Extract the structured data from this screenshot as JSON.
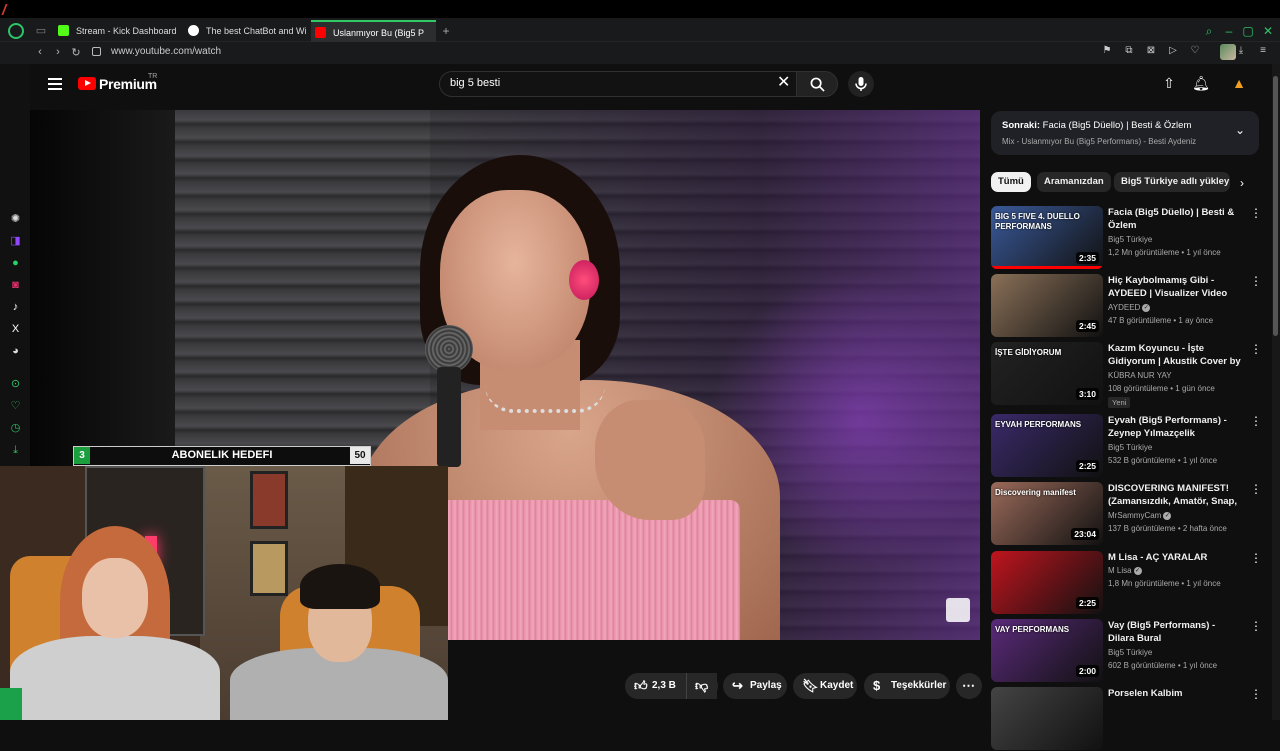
{
  "browser": {
    "tabs": [
      {
        "label": "Stream - Kick Dashboard",
        "color": "#53fc18"
      },
      {
        "label": "The best ChatBot and Wi",
        "color": "#ffffff"
      },
      {
        "label": "Uslanmıyor Bu (Big5 P",
        "color": "#ff0000",
        "active": true
      }
    ],
    "url": "www.youtube.com/watch"
  },
  "youtube": {
    "logo_text": "Premium",
    "country": "TR",
    "search_value": "big 5 besti"
  },
  "overlay": {
    "sub_goal_label": "ABONELIK HEDEFI",
    "sub_goal_current": "3",
    "sub_goal_target": "50"
  },
  "actions": {
    "likes": "2,3 B",
    "share": "Paylaş",
    "save": "Kaydet",
    "thanks": "Teşekkürler"
  },
  "next_up": {
    "label": "Sonraki:",
    "title": "Facia (Big5 Düello) | Besti & Özlem",
    "subtitle": "Mix - Uslanmıyor Bu (Big5 Performans) - Besti Aydeniz"
  },
  "chips": [
    "Tümü",
    "Aramanızdan",
    "Big5 Türkiye adlı yükley"
  ],
  "recommendations": [
    {
      "title": "Facia (Big5 Düello) | Besti & Özlem",
      "channel": "Big5 Türkiye",
      "meta": "1,2 Mn görüntüleme • 1 yıl önce",
      "duration": "2:35",
      "thumb_text": "BIG 5 FIVE 4. DUELLO PERFORMANS",
      "bg": "#3a5a9a"
    },
    {
      "title": "Hiç Kaybolmamış Gibi - AYDEED | Visualizer Video",
      "channel": "AYDEED",
      "verified": true,
      "meta": "47 B görüntüleme • 1 ay önce",
      "duration": "2:45",
      "thumb_text": "",
      "bg": "#8a7058"
    },
    {
      "title": "Kazım Koyuncu - İşte Gidiyorum | Akustik Cover by Nur",
      "channel": "KÜBRA NUR YAY",
      "meta": "108 görüntüleme • 1 gün önce",
      "badge": "Yeni",
      "duration": "3:10",
      "thumb_text": "İŞTE GİDİYORUM",
      "bg": "#222222"
    },
    {
      "title": "Eyvah (Big5 Performans) - Zeynep Yılmazçelik",
      "channel": "Big5 Türkiye",
      "meta": "532 B görüntüleme • 1 yıl önce",
      "duration": "2:25",
      "thumb_text": "EYVAH PERFORMANS",
      "bg": "#3a2a6a"
    },
    {
      "title": "DISCOVERING MANIFEST! (Zamansızdık, Amatör, Snap, ...",
      "channel": "MrSammyCam",
      "verified": true,
      "meta": "137 B görüntüleme • 2 hafta önce",
      "duration": "23:04",
      "thumb_text": "Discovering manifest",
      "bg": "#9a6a5a"
    },
    {
      "title": "M Lisa - AÇ YARALAR",
      "channel": "M Lisa",
      "verified": true,
      "meta": "1,8 Mn görüntüleme • 1 yıl önce",
      "duration": "2:25",
      "thumb_text": "",
      "bg": "#c0141e"
    },
    {
      "title": "Vay (Big5 Performans) - Dilara Bural",
      "channel": "Big5 Türkiye",
      "meta": "602 B görüntüleme • 1 yıl önce",
      "duration": "2:00",
      "thumb_text": "VAY PERFORMANS",
      "bg": "#5a2a7a"
    },
    {
      "title": "Porselen Kalbim",
      "channel": "",
      "meta": "",
      "duration": "",
      "thumb_text": "",
      "bg": "#444444"
    }
  ]
}
